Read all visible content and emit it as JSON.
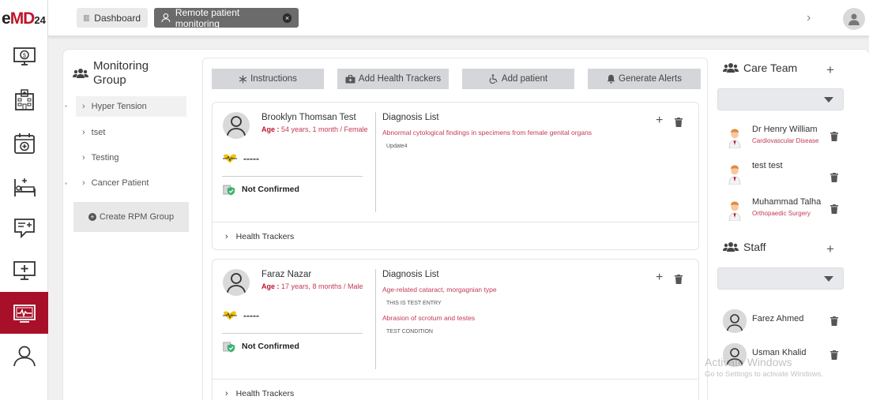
{
  "app": {
    "logo": {
      "part1": "e",
      "part2": "MD",
      "part3": "24"
    },
    "tabs": [
      {
        "label": "Dashboard",
        "icon": "grid-icon"
      },
      {
        "label": "Remote patient monitoring",
        "icon": "user-icon",
        "close": "×"
      }
    ],
    "chevron": "›",
    "rail_items": [
      "billing-monitor-icon",
      "hospital-icon",
      "calendar-plus-icon",
      "hospital-bed-icon",
      "chat-medical-icon",
      "monitor-medical-icon",
      "rpm-monitor-icon",
      "user-icon"
    ],
    "active_rail": "rpm-monitor-icon"
  },
  "monitoring_group": {
    "title": "Monitoring Group",
    "items": [
      "Hyper Tension",
      "tset",
      "Testing",
      "Cancer Patient"
    ],
    "active": "Hyper Tension",
    "create_label": "Create RPM Group",
    "plus": "+"
  },
  "actions": [
    "Instructions",
    "Add Health Trackers",
    "Add patient",
    "Generate Alerts"
  ],
  "patients": [
    {
      "name": "Brooklyn Thomsan Test",
      "age_label": "Age :",
      "age_value": "54 years, 1 month / Female",
      "vital": "-----",
      "status": "Not Confirmed",
      "diagnosis_title": "Diagnosis List",
      "diagnoses": [
        {
          "name": "Abnormal cytological findings in specimens from female genital organs",
          "note": "Update4"
        }
      ],
      "trackers_label": "Health Trackers"
    },
    {
      "name": "Faraz Nazar",
      "age_label": "Age :",
      "age_value": "17 years, 8 months / Male",
      "vital": "-----",
      "status": "Not Confirmed",
      "diagnosis_title": "Diagnosis List",
      "diagnoses": [
        {
          "name": "Age-related cataract, morgagnian type",
          "note": "THIS IS TEST ENTRY"
        },
        {
          "name": "Abrasion of scrotum and testes",
          "note": "TEST CONDITION"
        }
      ],
      "trackers_label": "Health Trackers"
    }
  ],
  "card_icons": {
    "plus": "+",
    "chevron": "›"
  },
  "care_team": {
    "title": "Care Team",
    "plus": "+",
    "members": [
      {
        "name": "Dr Henry William",
        "specialty": "Cardiovascular Disease"
      },
      {
        "name": "test test",
        "specialty": ""
      },
      {
        "name": "Muhammad Talha",
        "specialty": "Orthopaedic Surgery"
      }
    ]
  },
  "staff": {
    "title": "Staff",
    "plus": "+",
    "members": [
      {
        "name": "Farez Ahmed"
      },
      {
        "name": "Usman Khalid"
      }
    ]
  },
  "watermark": {
    "line1": "Activate Windows",
    "line2": "Go to Settings to activate Windows."
  },
  "colors": {
    "accent": "#a8102a",
    "danger_text": "#c43a58",
    "button_bg": "#d4d6da"
  }
}
